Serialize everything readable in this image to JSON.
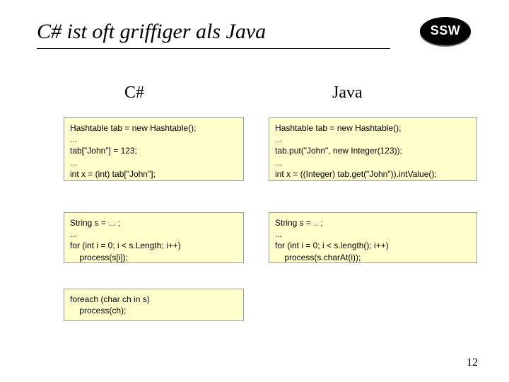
{
  "slide": {
    "title": "C# ist oft griffiger als Java",
    "logo_text": "SSW",
    "page_number": "12"
  },
  "columns": {
    "left_header": "C#",
    "right_header": "Java"
  },
  "code": {
    "csharp_block1": "Hashtable tab = new Hashtable();\n...\ntab[\"John\"] = 123;\n...\nint x = (int) tab[\"John\"];",
    "java_block1": "Hashtable tab = new Hashtable();\n...\ntab.put(\"John\", new Integer(123));\n...\nint x = ((Integer) tab.get(\"John\")).intValue();",
    "csharp_block2": "String s = ... ;\n...\nfor (int i = 0; i < s.Length; i++)\n    process(s[i]);",
    "java_block2": "String s = .. ;\n...\nfor (int i = 0; i < s.length(); i++)\n    process(s.charAt(i));",
    "csharp_block3": "foreach (char ch in s)\n    process(ch);"
  }
}
